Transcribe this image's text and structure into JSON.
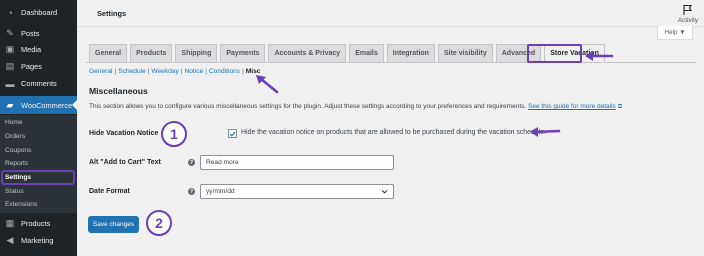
{
  "sidebar": {
    "items": [
      {
        "label": "Dashboard",
        "icon": "dashboard-icon"
      },
      {
        "label": "Posts",
        "icon": "pin-icon"
      },
      {
        "label": "Media",
        "icon": "media-icon"
      },
      {
        "label": "Pages",
        "icon": "page-icon"
      },
      {
        "label": "Comments",
        "icon": "comment-icon"
      },
      {
        "label": "WooCommerce",
        "icon": "woo-icon"
      },
      {
        "label": "Products",
        "icon": "box-icon"
      },
      {
        "label": "Marketing",
        "icon": "megaphone-icon"
      }
    ],
    "submenu": [
      "Home",
      "Orders",
      "Coupons",
      "Reports",
      "Settings",
      "Status",
      "Extensions"
    ],
    "active_item": "WooCommerce",
    "current_submenu": "Settings"
  },
  "header": {
    "title": "Settings",
    "activity_label": "Activity",
    "help_label": "Help ▼"
  },
  "tabs": [
    "General",
    "Products",
    "Shipping",
    "Payments",
    "Accounts & Privacy",
    "Emails",
    "Integration",
    "Site visibility",
    "Advanced",
    "Store Vacation"
  ],
  "active_tab": "Store Vacation",
  "subnav": {
    "links": [
      "General",
      "Schedule",
      "Weekday",
      "Notice",
      "Conditions"
    ],
    "current": "Misc"
  },
  "section": {
    "title": "Miscellaneous",
    "description": "This section allows you to configure various miscellaneous settings for the plugin. Adjust these settings according to your preferences and requirements.",
    "guide_link": "See this guide for more details"
  },
  "fields": {
    "hide_notice": {
      "label": "Hide Vacation Notice",
      "checked": true,
      "description": "Hide the vacation notice on products that are allowed to be purchased during the vacation schedule."
    },
    "add_to_cart": {
      "label": "Alt \"Add to Cart\" Text",
      "value": "Read more",
      "help": "?"
    },
    "date_format": {
      "label": "Date Format",
      "value": "yy/mm/dd",
      "help": "?"
    }
  },
  "save_label": "Save changes",
  "annotations": {
    "step1": "1",
    "step2": "2"
  },
  "colors": {
    "accent": "#2271b1",
    "sidebar_bg": "#1d2327",
    "annotation": "#6b3fb5"
  }
}
